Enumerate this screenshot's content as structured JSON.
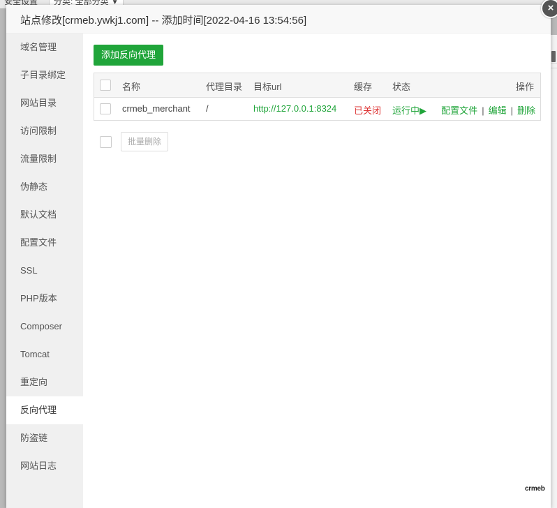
{
  "background": {
    "left_text": "安全设置",
    "select_label": "分类: 全部分类",
    "select_caret": "▼"
  },
  "dialog": {
    "title": "站点修改[crmeb.ywkj1.com] -- 添加时间[2022-04-16 13:54:56]",
    "close_icon": "×"
  },
  "sidebar": {
    "items": [
      {
        "label": "域名管理"
      },
      {
        "label": "子目录绑定"
      },
      {
        "label": "网站目录"
      },
      {
        "label": "访问限制"
      },
      {
        "label": "流量限制"
      },
      {
        "label": "伪静态"
      },
      {
        "label": "默认文档"
      },
      {
        "label": "配置文件"
      },
      {
        "label": "SSL"
      },
      {
        "label": "PHP版本"
      },
      {
        "label": "Composer"
      },
      {
        "label": "Tomcat"
      },
      {
        "label": "重定向"
      },
      {
        "label": "反向代理"
      },
      {
        "label": "防盗链"
      },
      {
        "label": "网站日志"
      }
    ],
    "active_index": 13
  },
  "main": {
    "add_button": "添加反向代理",
    "table": {
      "headers": {
        "name": "名称",
        "proxy_dir": "代理目录",
        "target_url": "目标url",
        "cache": "缓存",
        "status": "状态",
        "actions": "操作"
      },
      "rows": [
        {
          "name": "crmeb_merchant",
          "proxy_dir": "/",
          "target_url": "http://127.0.0.1:8324",
          "cache": "已关闭",
          "status": "运行中▶",
          "action_config": "配置文件",
          "action_edit": "编辑",
          "action_delete": "删除",
          "separator": "|"
        }
      ]
    },
    "batch_delete_button": "批量删除"
  },
  "logo_text": "crmeb",
  "colors": {
    "accent_green": "#20a53a",
    "status_red": "#dd3333",
    "sidebar_bg": "#f0f0f0"
  }
}
